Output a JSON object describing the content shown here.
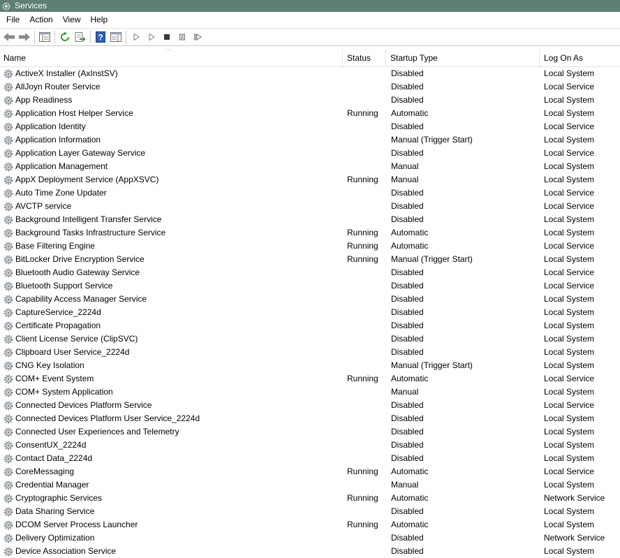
{
  "window": {
    "title": "Services"
  },
  "menu": [
    "File",
    "Action",
    "View",
    "Help"
  ],
  "columns": {
    "name": "Name",
    "status": "Status",
    "startup": "Startup Type",
    "logon": "Log On As"
  },
  "services": [
    {
      "name": "ActiveX Installer (AxInstSV)",
      "status": "",
      "startup": "Disabled",
      "logon": "Local System"
    },
    {
      "name": "AllJoyn Router Service",
      "status": "",
      "startup": "Disabled",
      "logon": "Local Service"
    },
    {
      "name": "App Readiness",
      "status": "",
      "startup": "Disabled",
      "logon": "Local System"
    },
    {
      "name": "Application Host Helper Service",
      "status": "Running",
      "startup": "Automatic",
      "logon": "Local System"
    },
    {
      "name": "Application Identity",
      "status": "",
      "startup": "Disabled",
      "logon": "Local Service"
    },
    {
      "name": "Application Information",
      "status": "",
      "startup": "Manual (Trigger Start)",
      "logon": "Local System"
    },
    {
      "name": "Application Layer Gateway Service",
      "status": "",
      "startup": "Disabled",
      "logon": "Local Service"
    },
    {
      "name": "Application Management",
      "status": "",
      "startup": "Manual",
      "logon": "Local System"
    },
    {
      "name": "AppX Deployment Service (AppXSVC)",
      "status": "Running",
      "startup": "Manual",
      "logon": "Local System"
    },
    {
      "name": "Auto Time Zone Updater",
      "status": "",
      "startup": "Disabled",
      "logon": "Local Service"
    },
    {
      "name": "AVCTP service",
      "status": "",
      "startup": "Disabled",
      "logon": "Local Service"
    },
    {
      "name": "Background Intelligent Transfer Service",
      "status": "",
      "startup": "Disabled",
      "logon": "Local System"
    },
    {
      "name": "Background Tasks Infrastructure Service",
      "status": "Running",
      "startup": "Automatic",
      "logon": "Local System"
    },
    {
      "name": "Base Filtering Engine",
      "status": "Running",
      "startup": "Automatic",
      "logon": "Local Service"
    },
    {
      "name": "BitLocker Drive Encryption Service",
      "status": "Running",
      "startup": "Manual (Trigger Start)",
      "logon": "Local System"
    },
    {
      "name": "Bluetooth Audio Gateway Service",
      "status": "",
      "startup": "Disabled",
      "logon": "Local Service"
    },
    {
      "name": "Bluetooth Support Service",
      "status": "",
      "startup": "Disabled",
      "logon": "Local Service"
    },
    {
      "name": "Capability Access Manager Service",
      "status": "",
      "startup": "Disabled",
      "logon": "Local System"
    },
    {
      "name": "CaptureService_2224d",
      "status": "",
      "startup": "Disabled",
      "logon": "Local System"
    },
    {
      "name": "Certificate Propagation",
      "status": "",
      "startup": "Disabled",
      "logon": "Local System"
    },
    {
      "name": "Client License Service (ClipSVC)",
      "status": "",
      "startup": "Disabled",
      "logon": "Local System"
    },
    {
      "name": "Clipboard User Service_2224d",
      "status": "",
      "startup": "Disabled",
      "logon": "Local System"
    },
    {
      "name": "CNG Key Isolation",
      "status": "",
      "startup": "Manual (Trigger Start)",
      "logon": "Local System"
    },
    {
      "name": "COM+ Event System",
      "status": "Running",
      "startup": "Automatic",
      "logon": "Local Service"
    },
    {
      "name": "COM+ System Application",
      "status": "",
      "startup": "Manual",
      "logon": "Local System"
    },
    {
      "name": "Connected Devices Platform Service",
      "status": "",
      "startup": "Disabled",
      "logon": "Local Service"
    },
    {
      "name": "Connected Devices Platform User Service_2224d",
      "status": "",
      "startup": "Disabled",
      "logon": "Local System"
    },
    {
      "name": "Connected User Experiences and Telemetry",
      "status": "",
      "startup": "Disabled",
      "logon": "Local System"
    },
    {
      "name": "ConsentUX_2224d",
      "status": "",
      "startup": "Disabled",
      "logon": "Local System"
    },
    {
      "name": "Contact Data_2224d",
      "status": "",
      "startup": "Disabled",
      "logon": "Local System"
    },
    {
      "name": "CoreMessaging",
      "status": "Running",
      "startup": "Automatic",
      "logon": "Local Service"
    },
    {
      "name": "Credential Manager",
      "status": "",
      "startup": "Manual",
      "logon": "Local System"
    },
    {
      "name": "Cryptographic Services",
      "status": "Running",
      "startup": "Automatic",
      "logon": "Network Service"
    },
    {
      "name": "Data Sharing Service",
      "status": "",
      "startup": "Disabled",
      "logon": "Local System"
    },
    {
      "name": "DCOM Server Process Launcher",
      "status": "Running",
      "startup": "Automatic",
      "logon": "Local System"
    },
    {
      "name": "Delivery Optimization",
      "status": "",
      "startup": "Disabled",
      "logon": "Network Service"
    },
    {
      "name": "Device Association Service",
      "status": "",
      "startup": "Disabled",
      "logon": "Local System"
    }
  ]
}
